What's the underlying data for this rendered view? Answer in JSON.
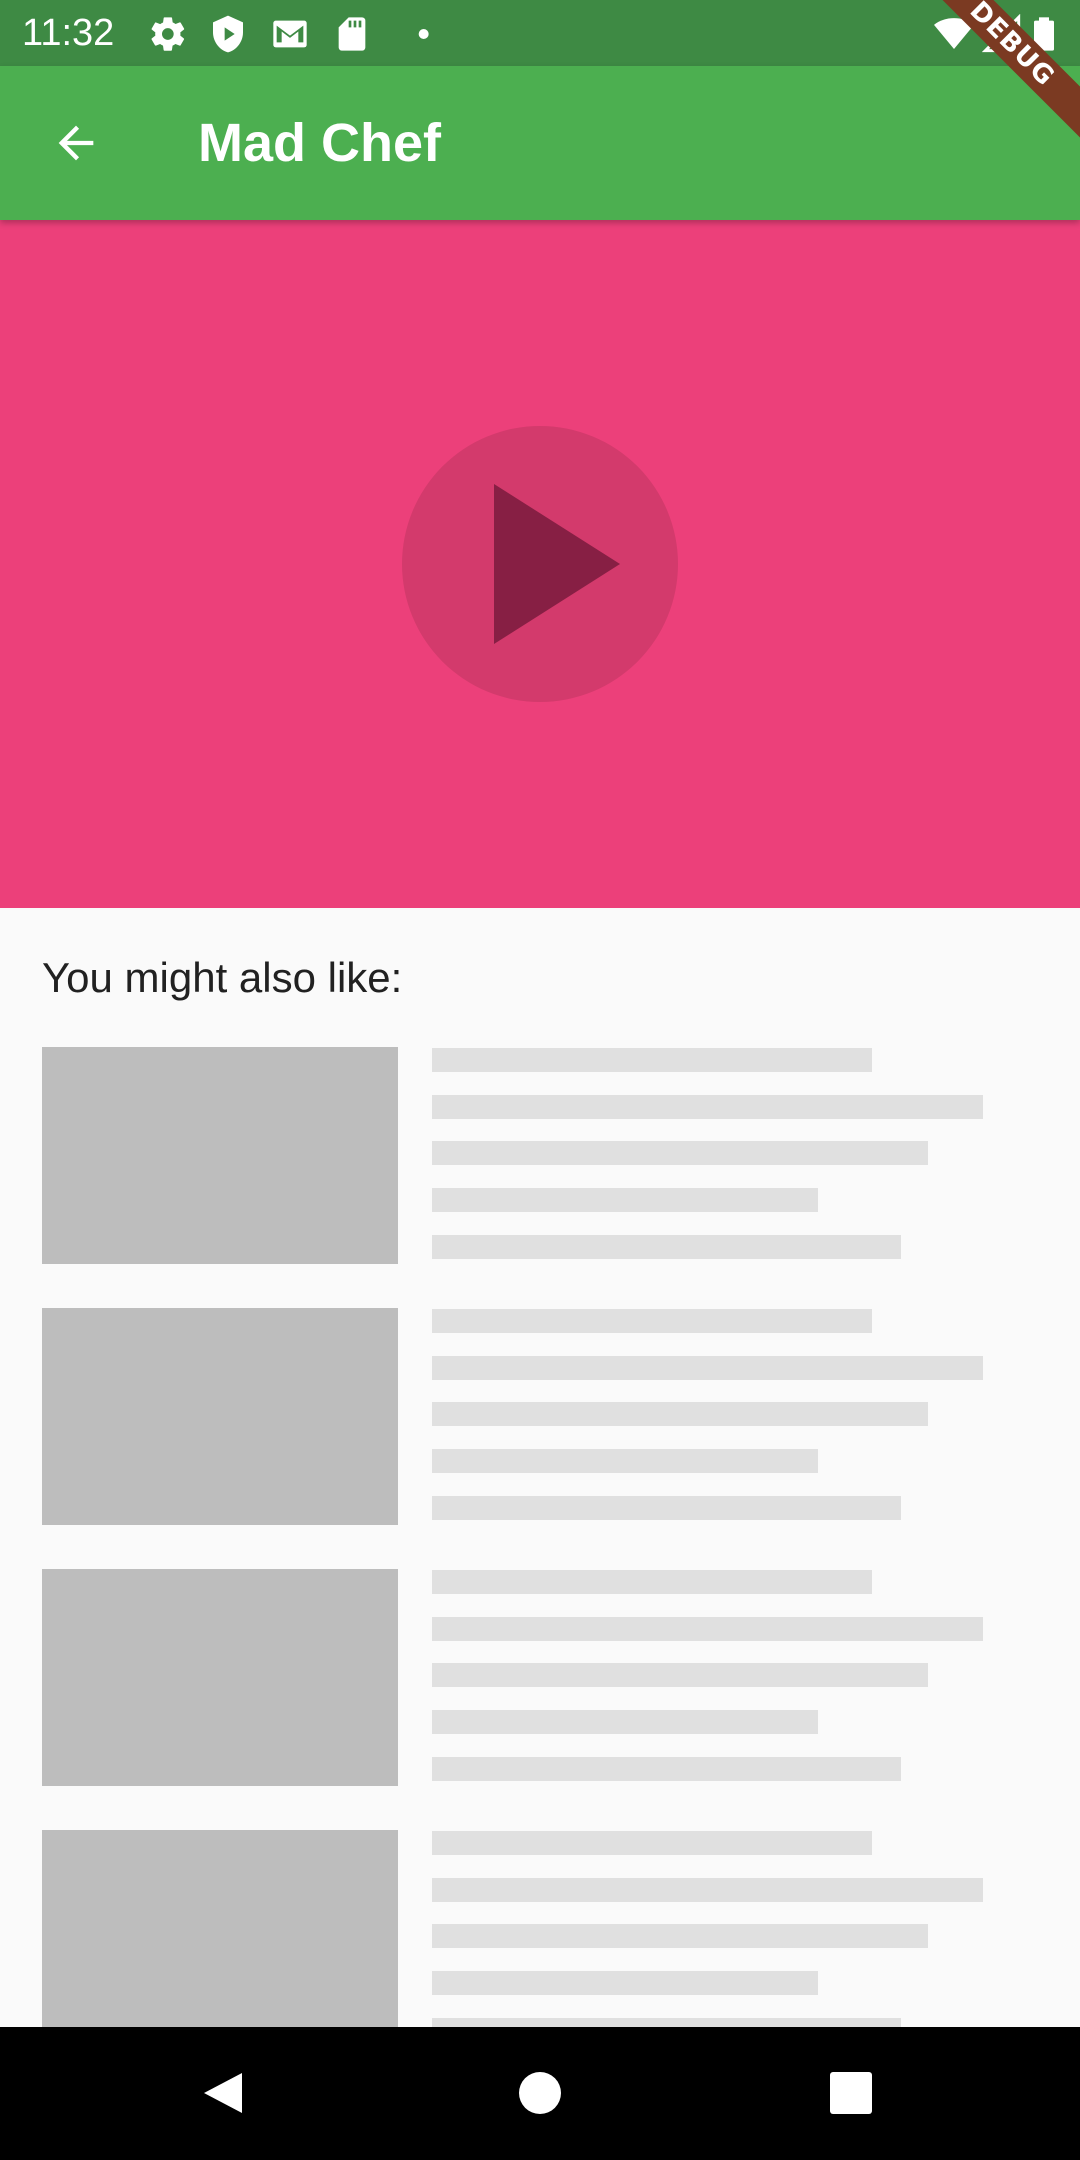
{
  "status_bar": {
    "time": "11:32",
    "icons": [
      "settings-icon",
      "shield-icon",
      "gmail-icon",
      "sd-card-icon",
      "dot-icon",
      "wifi-icon",
      "signal-icon",
      "battery-icon"
    ]
  },
  "debug_banner": "DEBUG",
  "app_bar": {
    "title": "Mad Chef",
    "back_icon": "arrow-back-icon",
    "color": "#4CAF50"
  },
  "video": {
    "background_color": "#EC407A",
    "play_icon": "play-icon"
  },
  "recommendations": {
    "title": "You might also like:",
    "items": [
      {
        "placeholder": true
      },
      {
        "placeholder": true
      },
      {
        "placeholder": true
      },
      {
        "placeholder": true
      }
    ]
  },
  "nav_bar": {
    "buttons": [
      "back-triangle-icon",
      "home-circle-icon",
      "recents-square-icon"
    ]
  }
}
